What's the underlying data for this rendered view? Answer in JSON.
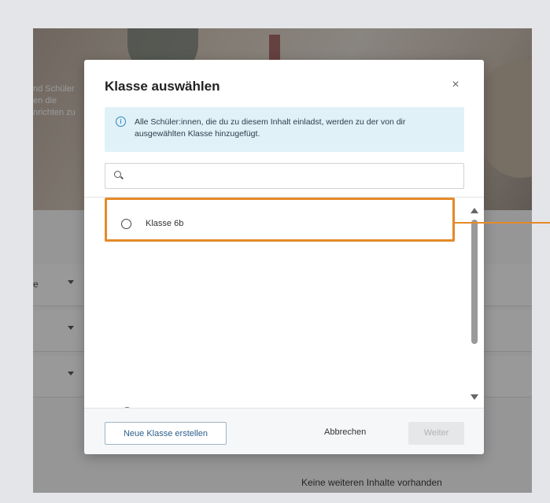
{
  "background": {
    "hero_text": [
      "nd Schüler",
      "en die",
      "nrichten zu"
    ],
    "filter_rows": [
      {
        "label": "e"
      },
      {
        "label": ""
      },
      {
        "label": ""
      }
    ],
    "bottom_text": "Keine weiteren Inhalte vorhanden"
  },
  "modal": {
    "title": "Klasse auswählen",
    "close_label": "×",
    "info_icon": "info-icon",
    "info_text": "Alle Schüler:innen, die du zu diesem Inhalt einladst, werden zu der von dir ausgewählten Klasse hinzugefügt.",
    "search": {
      "placeholder": "",
      "value": ""
    },
    "classes": [
      {
        "label": "Klasse 6b",
        "selected": false
      }
    ],
    "footer": {
      "new_class_label": "Neue Klasse erstellen",
      "cancel_label": "Abbrechen",
      "next_label": "Weiter",
      "next_disabled": true
    }
  },
  "colors": {
    "highlight": "#e48a2a",
    "info_bg": "#e0f1f8",
    "info_accent": "#2e87c2"
  }
}
